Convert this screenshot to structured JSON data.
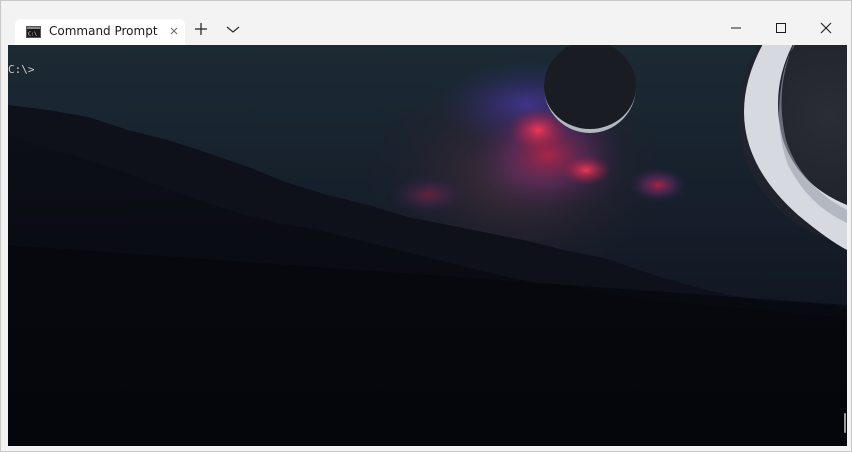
{
  "window": {
    "tab_title": "Command Prompt",
    "tab_icon": "console-icon",
    "tab_close_icon": "close-icon",
    "new_tab_icon": "plus-icon",
    "dropdown_icon": "chevron-down-icon",
    "minimize_icon": "minimize-icon",
    "maximize_icon": "maximize-icon",
    "close_icon": "close-icon"
  },
  "terminal": {
    "prompt": "C:\\>",
    "background": "space-landscape-wallpaper"
  },
  "colors": {
    "titlebar": "#f3f3f3",
    "tab": "#ffffff",
    "terminal_bg": "#060710",
    "text": "#cccccc"
  }
}
